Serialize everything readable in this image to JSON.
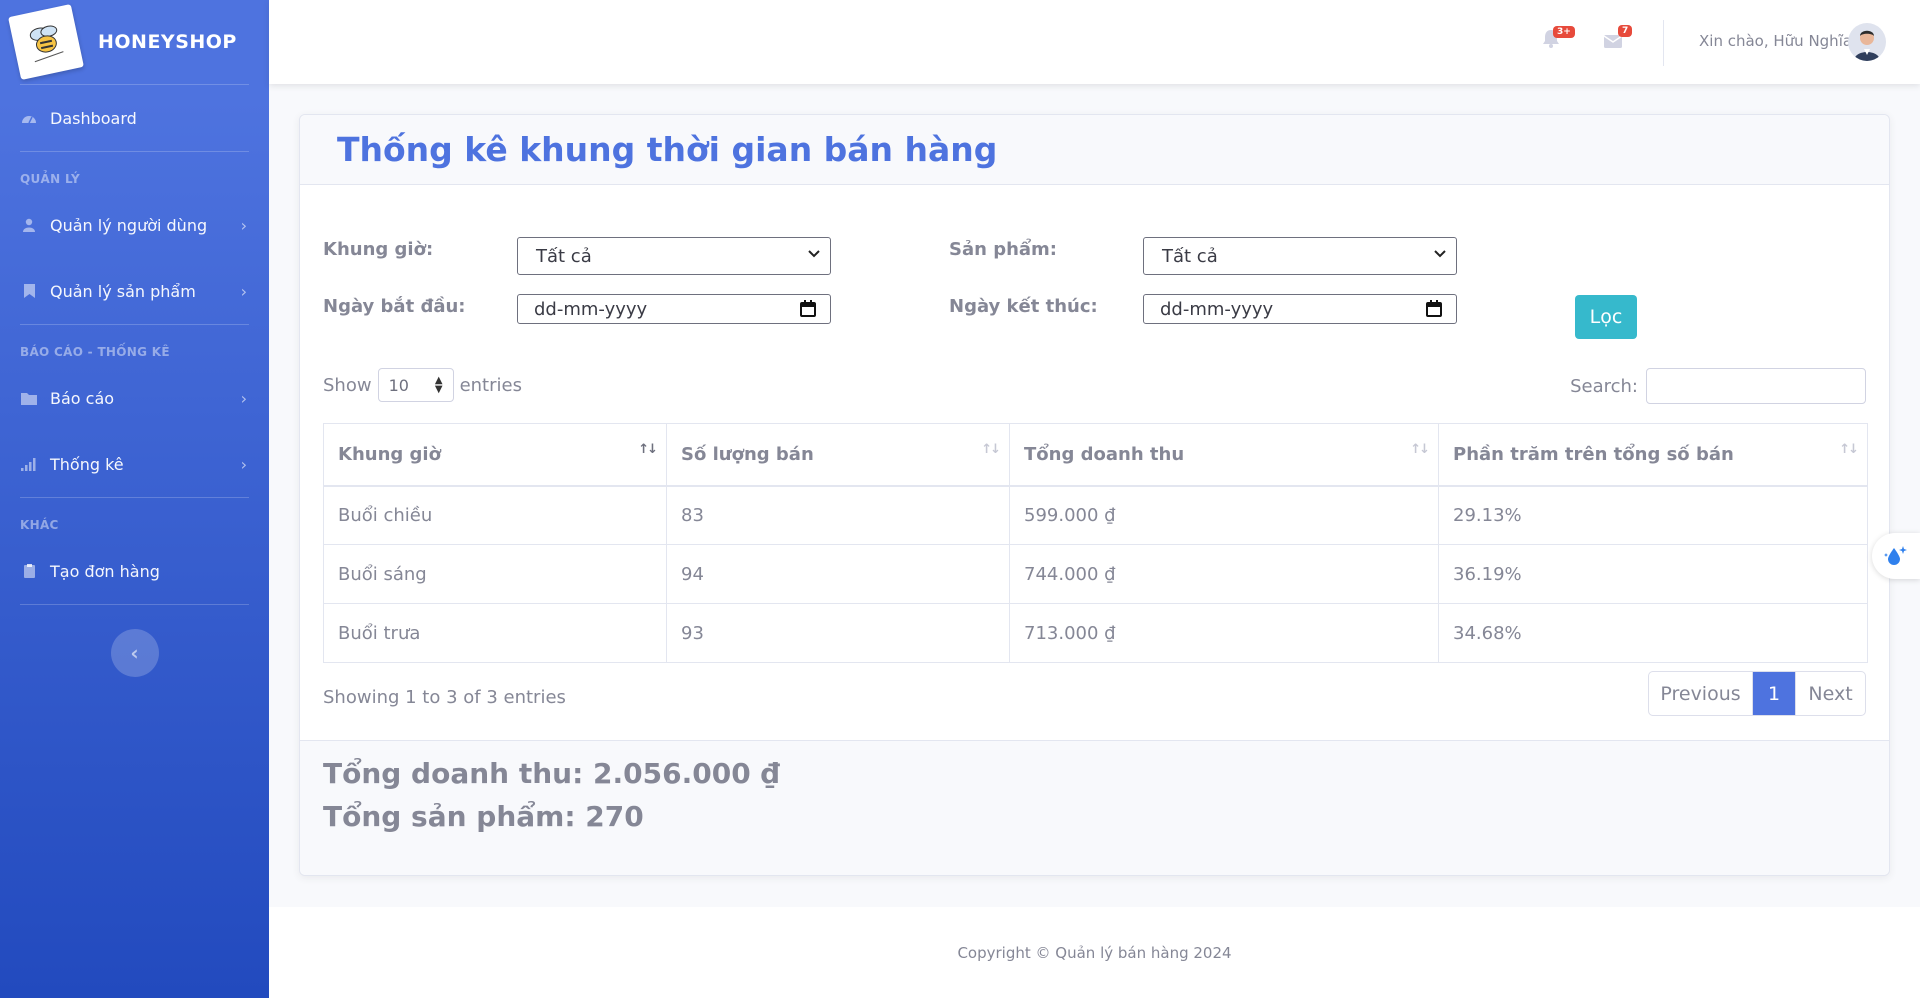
{
  "brand": {
    "name": "HONEYSHOP"
  },
  "sidebar": {
    "dashboard": "Dashboard",
    "section_manage": "QUẢN LÝ",
    "users": "Quản lý người dùng",
    "products": "Quản lý sản phẩm",
    "section_reports": "BÁO CÁO - THỐNG KÊ",
    "reports": "Báo cáo",
    "stats": "Thống kê",
    "section_other": "KHÁC",
    "create_order": "Tạo đơn hàng"
  },
  "topbar": {
    "alerts_badge": "3+",
    "messages_badge": "7",
    "greeting": "Xin chào, Hữu Nghĩa"
  },
  "page": {
    "title": "Thống kê khung thời gian bán hàng"
  },
  "filters": {
    "time_label": "Khung giờ:",
    "time_value": "Tất cả",
    "product_label": "Sản phẩm:",
    "product_value": "Tất cả",
    "start_label": "Ngày bắt đầu:",
    "start_value": "dd-mm-yyyy",
    "end_label": "Ngày kết thúc:",
    "end_value": "dd-mm-yyyy",
    "filter_button": "Lọc"
  },
  "table_controls": {
    "show": "Show",
    "page_length": "10",
    "entries": "entries",
    "search": "Search:"
  },
  "table": {
    "headers": [
      "Khung giờ",
      "Số lượng bán",
      "Tổng doanh thu",
      "Phần trăm trên tổng số bán"
    ],
    "rows": [
      [
        "Buổi chiều",
        "83",
        "599.000 ₫",
        "29.13%"
      ],
      [
        "Buổi sáng",
        "94",
        "744.000 ₫",
        "36.19%"
      ],
      [
        "Buổi trưa",
        "93",
        "713.000 ₫",
        "34.68%"
      ]
    ]
  },
  "pagination": {
    "info": "Showing 1 to 3 of 3 entries",
    "previous": "Previous",
    "current": "1",
    "next": "Next"
  },
  "summary": {
    "total_revenue": "Tổng doanh thu: 2.056.000 ₫",
    "total_products": "Tổng sản phẩm: 270"
  },
  "footer": {
    "copyright": "Copyright © Quản lý bán hàng 2024"
  },
  "colors": {
    "primary": "#4e73df",
    "info": "#36b9cc",
    "danger": "#e74a3b"
  }
}
